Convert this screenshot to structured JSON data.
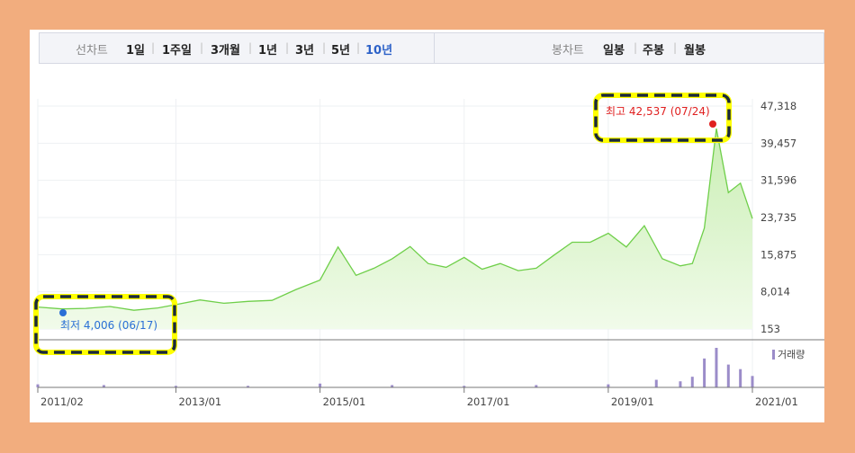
{
  "tabs_left": {
    "label": "선차트",
    "items": [
      "1일",
      "1주일",
      "3개월",
      "1년",
      "3년",
      "5년",
      "10년"
    ],
    "active_index": 6
  },
  "tabs_right": {
    "label": "봉차트",
    "items": [
      "일봉",
      "주봉",
      "월봉"
    ]
  },
  "colors": {
    "line": "#6fcf4a",
    "fill_top": "#c9eeb3",
    "fill_bottom": "#f1fbea",
    "high": "#e02020",
    "low": "#2a6fd6",
    "volume": "#9b8cc9",
    "highlight_border": "#ffff00",
    "highlight_dash": "#1b2a3a",
    "background_frame": "#f2ad7e"
  },
  "chart_data": {
    "type": "area",
    "y_ticks": [
      "47,318",
      "39,457",
      "31,596",
      "23,735",
      "15,875",
      "8,014",
      "153"
    ],
    "ylim": [
      153,
      47318
    ],
    "x_ticks": [
      "2011/02",
      "2013/01",
      "2015/01",
      "2017/01",
      "2019/01",
      "2021/01"
    ],
    "high_annotation": "최고 42,537 (07/24)",
    "low_annotation": "최저 4,006 (06/17)",
    "volume_legend": "거래량",
    "series": [
      {
        "x": [
          "2011/02",
          "2011/06",
          "2011/10",
          "2012/02",
          "2012/06",
          "2012/10",
          "2013/01",
          "2013/05",
          "2013/09",
          "2014/01",
          "2014/05",
          "2014/09",
          "2015/01",
          "2015/04",
          "2015/07",
          "2015/10",
          "2016/01",
          "2016/04",
          "2016/07",
          "2016/10",
          "2017/01",
          "2017/04",
          "2017/07",
          "2017/10",
          "2018/01",
          "2018/04",
          "2018/07",
          "2018/10",
          "2019/01",
          "2019/04",
          "2019/07",
          "2019/10",
          "2020/01",
          "2020/03",
          "2020/05",
          "2020/07",
          "2020/09",
          "2020/11",
          "2021/01"
        ],
        "values": [
          4800,
          4400,
          4500,
          4900,
          4100,
          4600,
          5300,
          6300,
          5600,
          6000,
          6200,
          8500,
          10500,
          17500,
          11500,
          13000,
          15000,
          17600,
          14000,
          13200,
          15300,
          12800,
          14000,
          12500,
          13000,
          15800,
          18500,
          18500,
          20400,
          17500,
          22000,
          15000,
          13500,
          14000,
          21500,
          42537,
          29000,
          31000,
          23500
        ]
      }
    ],
    "volume": {
      "x": [
        "2011/02",
        "2012/01",
        "2013/01",
        "2014/01",
        "2015/01",
        "2016/01",
        "2017/01",
        "2018/01",
        "2019/01",
        "2019/09",
        "2020/01",
        "2020/03",
        "2020/05",
        "2020/07",
        "2020/09",
        "2020/11",
        "2021/01"
      ],
      "values": [
        4,
        3,
        2,
        2,
        5,
        3,
        2,
        3,
        4,
        10,
        8,
        14,
        38,
        52,
        30,
        24,
        15
      ]
    }
  }
}
